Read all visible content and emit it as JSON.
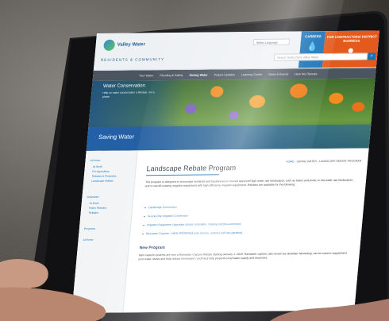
{
  "header": {
    "logo_text": "Valley Water",
    "section": "RESIDENTS & COMMUNITY",
    "language_select": "Select Language",
    "search_placeholder": "Search Santa Clara Valley Water",
    "careers_label": "CAREERS",
    "contractors_label": "FOR CONTRACTORS/ DISTRICT BUSINESS"
  },
  "nav": {
    "items": [
      "Your Water",
      "Flooding & Safety",
      "Saving Water",
      "Project Updates",
      "Learning Center",
      "News & Events",
      "How We Operate"
    ],
    "active_index": 2
  },
  "hero": {
    "title": "Water Conservation",
    "subtitle": "Help us make conservation a lifestyle, not a phase",
    "band_title": "Saving Water"
  },
  "sidebar": {
    "items": [
      "At Home",
      "At Work",
      "For Agriculture",
      "Rebates & Programs",
      "Landscape Rebate",
      "Graywater",
      "At Work",
      "Home Rebates",
      "Rebates",
      "Programs",
      "At Home"
    ]
  },
  "main": {
    "breadcrumb_home": "HOME",
    "breadcrumb_rest": "› SAVING WATER › LANDSCAPE REBATE PROGRAM",
    "page_title": "Landscape Rebate Program",
    "intro": "The program is designed to encourage residents and businesses to convert approved high water use landscapes, such as lawns and pools, to low water use landscapes, and to retrofit existing irrigation equipment with high efficiency irrigation equipment. Rebates are available for the following:",
    "bullets": [
      "Landscape Conversion",
      "In-Line Drip Irrigation Conversion",
      "Irrigation Equipment Upgrades (smart controllers, rotating nozzles and more)",
      "Rainwater Capture - NEW PROGRAM (rain barrels, cisterns and rain gardens)"
    ],
    "new_program_heading": "New Program",
    "new_program_text": "Rain capture systems are now a Rainwater Capture Rebate starting January 1, 2019. Rainwater capture, also known as rainwater harvesting, can be used to supplement your water needs and help reduce stormwater runoff and help preserve local water supply and reservoirs."
  }
}
